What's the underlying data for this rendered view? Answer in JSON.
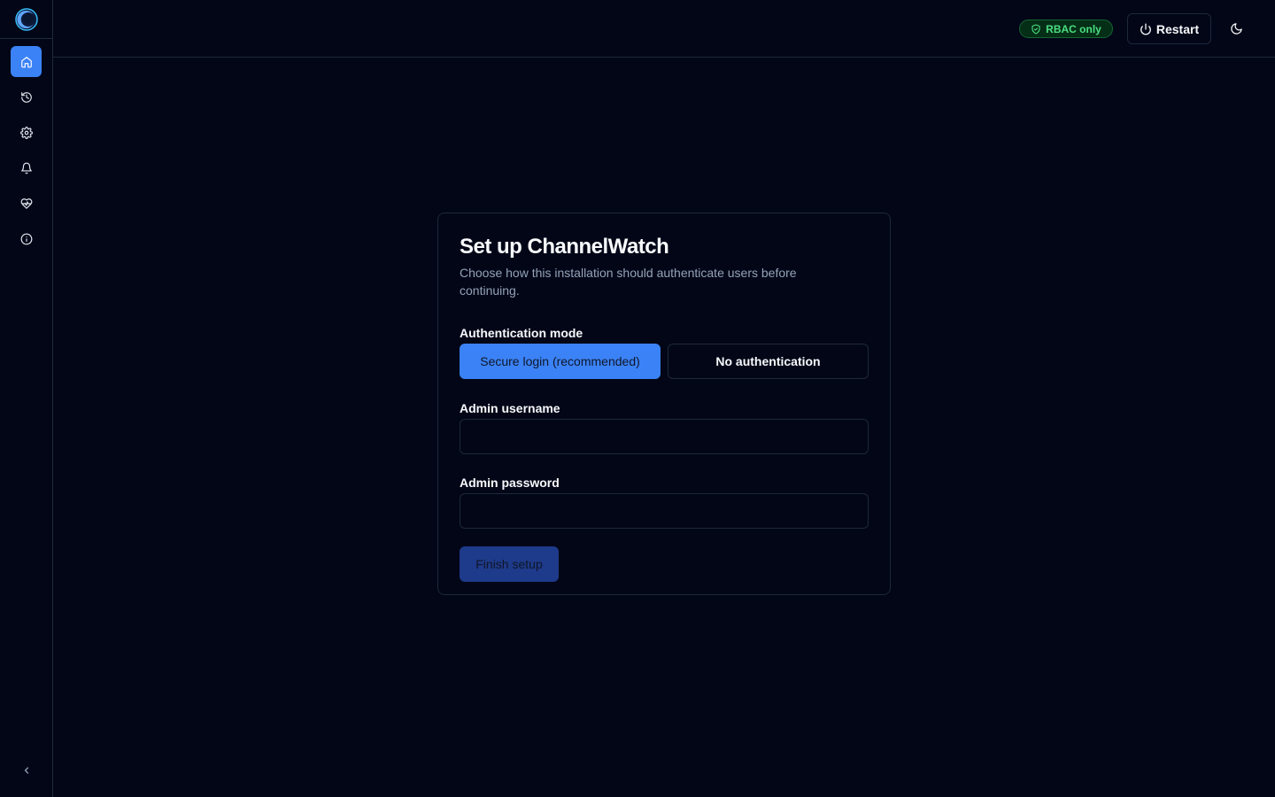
{
  "app": {
    "name": "ChannelWatch"
  },
  "sidebar": {
    "items": [
      {
        "icon": "home-icon",
        "active": true
      },
      {
        "icon": "history-icon",
        "active": false
      },
      {
        "icon": "gear-icon",
        "active": false
      },
      {
        "icon": "bell-icon",
        "active": false
      },
      {
        "icon": "heart-pulse-icon",
        "active": false
      },
      {
        "icon": "info-icon",
        "active": false
      }
    ],
    "collapse_icon": "chevron-left-icon"
  },
  "header": {
    "badge_label": "RBAC only",
    "restart_label": "Restart",
    "theme_icon": "moon-icon"
  },
  "setup": {
    "title": "Set up ChannelWatch",
    "description": "Choose how this installation should authenticate users before continuing.",
    "auth_mode_label": "Authentication mode",
    "mode_secure": "Secure login (recommended)",
    "mode_none": "No authentication",
    "username_label": "Admin username",
    "username_value": "",
    "password_label": "Admin password",
    "password_value": "",
    "finish_label": "Finish setup"
  },
  "colors": {
    "background": "#020617",
    "accent": "#3b82f6",
    "border": "#1e293b",
    "badge_green": "#4ade80"
  }
}
